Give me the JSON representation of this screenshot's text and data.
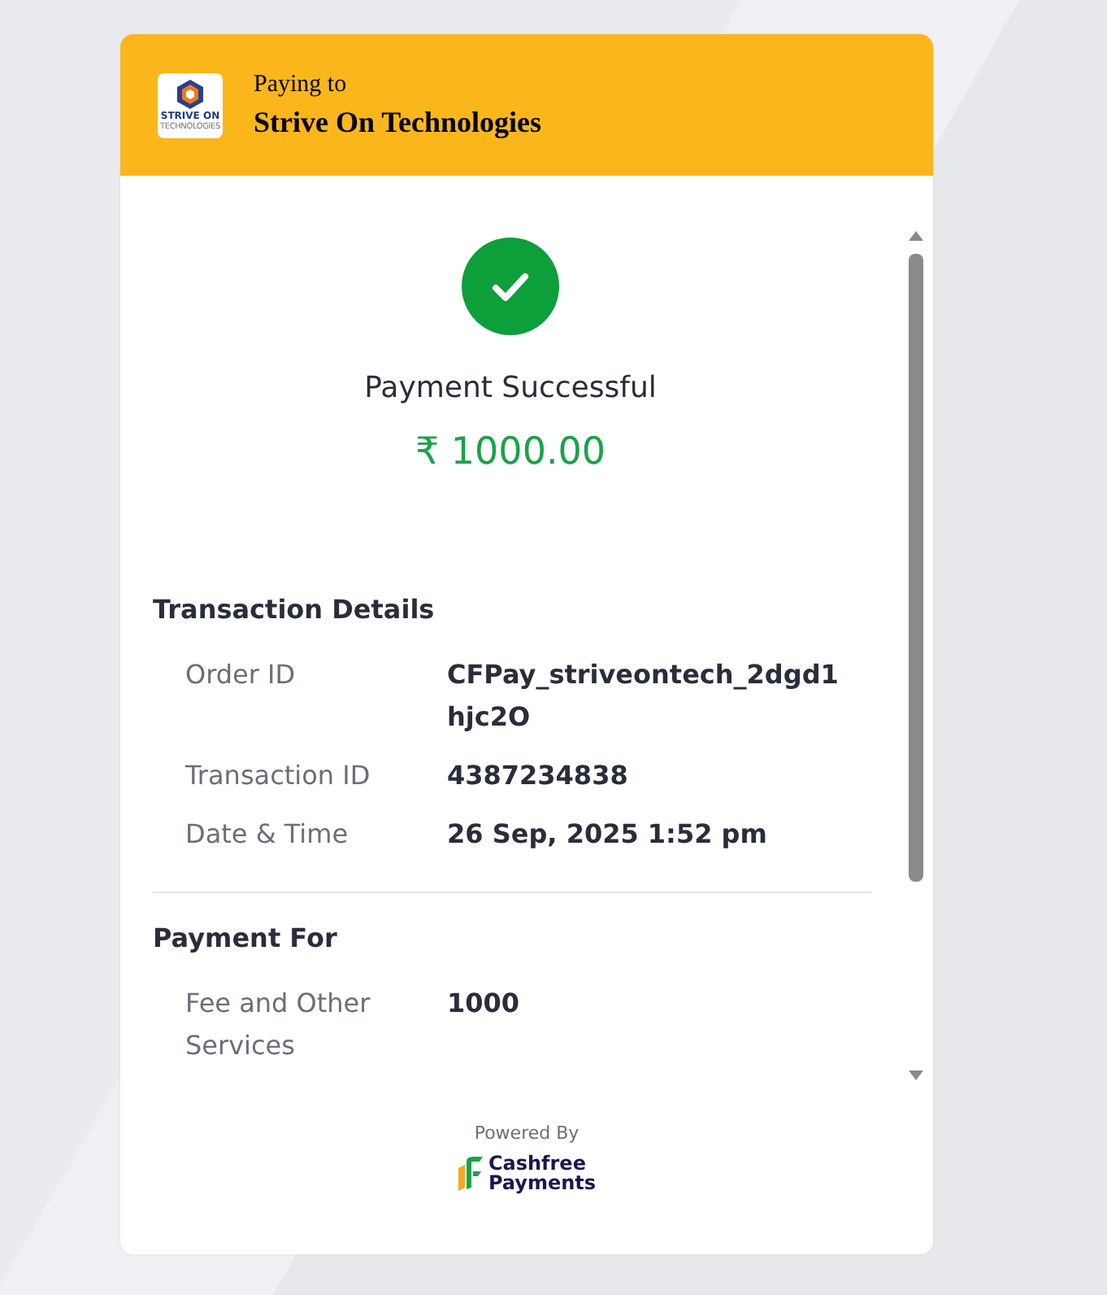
{
  "header": {
    "logo": {
      "line_1": "STRIVE ON",
      "line_2": "TECHNOLOGIES"
    },
    "caption": "Paying to",
    "merchant": "Strive On Technologies"
  },
  "status": {
    "title": "Payment Successful",
    "amount": "₹ 1000.00"
  },
  "sections": [
    {
      "title": "Transaction Details",
      "rows": [
        {
          "label": "Order ID",
          "value": "CFPay_striveontech_2dgd1hjc2O"
        },
        {
          "label": "Transaction ID",
          "value": "4387234838"
        },
        {
          "label": "Date & Time",
          "value": "26 Sep, 2025 1:52 pm"
        }
      ]
    },
    {
      "title": "Payment For",
      "rows": [
        {
          "label": "Fee and Other Services",
          "value": "1000"
        }
      ]
    }
  ],
  "footer": {
    "powered_by": "Powered By",
    "brand_line_1": "Cashfree",
    "brand_line_2": "Payments"
  }
}
